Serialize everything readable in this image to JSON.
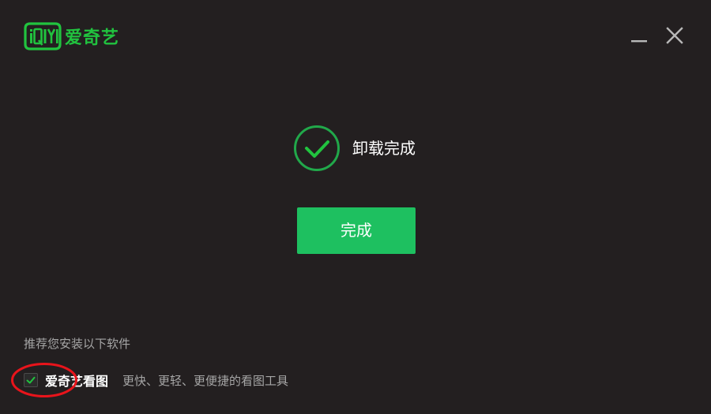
{
  "app": {
    "logo_mark_text": "iQIYI",
    "logo_text": "爱奇艺"
  },
  "window_controls": {
    "minimize_icon": "minimize-icon",
    "close_icon": "close-icon"
  },
  "status": {
    "icon": "check-circle-icon",
    "text": "卸载完成"
  },
  "done_button": {
    "label": "完成"
  },
  "recommend": {
    "title": "推荐您安装以下软件",
    "items": [
      {
        "checked": true,
        "name": "爱奇艺看图",
        "description": "更快、更轻、更便捷的看图工具"
      }
    ]
  },
  "colors": {
    "background": "#231f20",
    "brand_green": "#21c33f",
    "button_green": "#1ec060",
    "annotation_red": "#e8141b"
  }
}
